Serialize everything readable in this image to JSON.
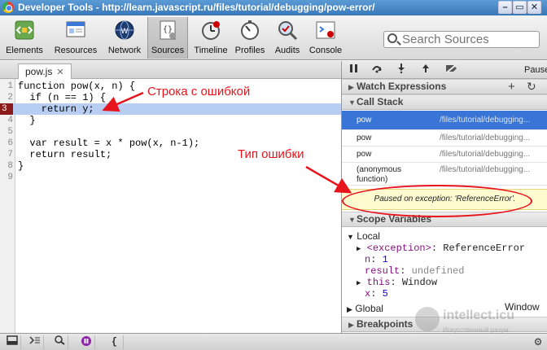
{
  "window": {
    "title": "Developer Tools - http://learn.javascript.ru/files/tutorial/debugging/pow-error/",
    "buttons": {
      "minimize": "–",
      "maximize": "▭",
      "close": "✕"
    }
  },
  "toolbar": {
    "panels": [
      {
        "label": "Elements",
        "icon": "elements-icon"
      },
      {
        "label": "Resources",
        "icon": "resources-icon"
      },
      {
        "label": "Network",
        "icon": "network-icon"
      },
      {
        "label": "Sources",
        "icon": "sources-icon",
        "active": true
      },
      {
        "label": "Timeline",
        "icon": "timeline-icon"
      },
      {
        "label": "Profiles",
        "icon": "profiles-icon"
      },
      {
        "label": "Audits",
        "icon": "audits-icon"
      },
      {
        "label": "Console",
        "icon": "console-icon"
      }
    ],
    "search_placeholder": "Search Sources"
  },
  "editor": {
    "file_tab": "pow.js",
    "file_tab_close": "✕",
    "lines": [
      {
        "n": "1",
        "code": "function pow(x, n) {"
      },
      {
        "n": "2",
        "code": "  if (n == 1) {"
      },
      {
        "n": "3",
        "code": "    return y;"
      },
      {
        "n": "4",
        "code": "  }"
      },
      {
        "n": "5",
        "code": ""
      },
      {
        "n": "6",
        "code": "  var result = x * pow(x, n-1);"
      },
      {
        "n": "7",
        "code": "  return result;"
      },
      {
        "n": "8",
        "code": "}"
      },
      {
        "n": "9",
        "code": ""
      }
    ]
  },
  "debugger": {
    "paused_label": "Pause",
    "watch_expressions": "Watch Expressions",
    "call_stack": "Call Stack",
    "frames": [
      {
        "fn": "pow",
        "loc": "/files/tutorial/debugging..."
      },
      {
        "fn": "pow",
        "loc": "/files/tutorial/debugging..."
      },
      {
        "fn": "pow",
        "loc": "/files/tutorial/debugging..."
      },
      {
        "fn": "(anonymous\nfunction)",
        "loc": "/files/tutorial/debugging..."
      }
    ],
    "exception_message": "Paused on exception: 'ReferenceError'.",
    "scope_variables": "Scope Variables",
    "local": "Local",
    "scope": {
      "exception_key": "<exception>",
      "exception_val": "ReferenceError",
      "n_key": "n",
      "n_val": "1",
      "result_key": "result",
      "result_val": "undefined",
      "this_key": "this",
      "this_val": "Window",
      "x_key": "x",
      "x_val": "5"
    },
    "global": "Global",
    "global_val": "Window",
    "breakpoints": "Breakpoints"
  },
  "annotations": {
    "error_line": "Строка с ошибкой",
    "error_type": "Тип ошибки"
  },
  "watermark": {
    "name": "intellect.icu",
    "tagline": "Искусственный разум"
  }
}
